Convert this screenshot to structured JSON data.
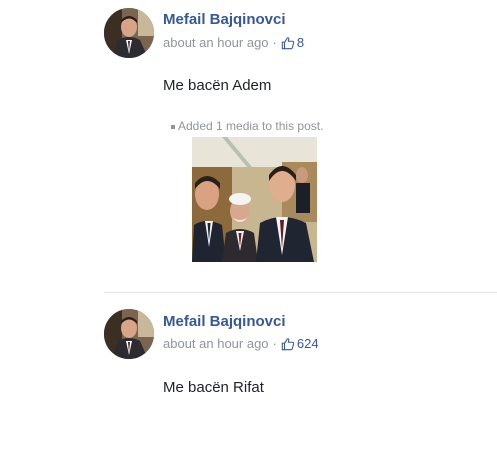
{
  "posts": [
    {
      "author": "Mefail Bajqinovci",
      "timestamp": "about an hour ago",
      "separator": "·",
      "like_icon": "thumbs-up-icon",
      "like_count": "8",
      "message": "Me bacën Adem",
      "media_note": "Added 1 media to this post."
    },
    {
      "author": "Mefail Bajqinovci",
      "timestamp": "about an hour ago",
      "separator": "·",
      "like_icon": "thumbs-up-icon",
      "like_count": "624",
      "message": "Me bacën Rifat"
    }
  ],
  "colors": {
    "author_link": "#365899",
    "meta_gray": "#90949c",
    "body_text": "#1d2129",
    "divider": "#e4e6eb"
  }
}
